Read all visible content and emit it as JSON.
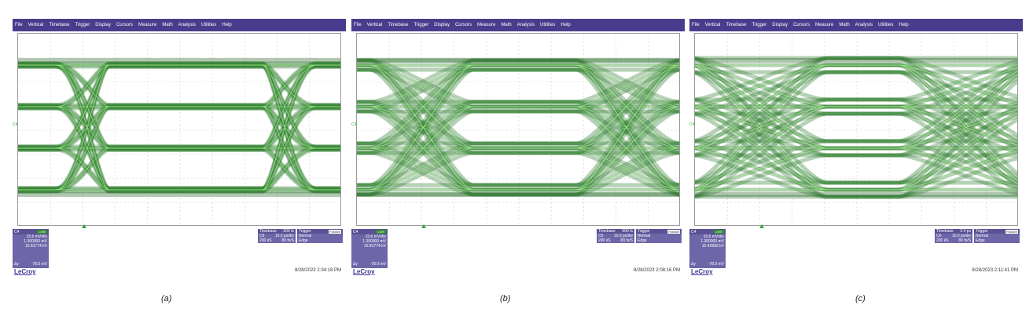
{
  "menu_items": [
    "File",
    "Vertical",
    "Timebase",
    "Trigger",
    "Display",
    "Cursors",
    "Measure",
    "Math",
    "Analysis",
    "Utilities",
    "Help"
  ],
  "colors": {
    "menubar": "#4a3c8c",
    "trace": "#2f8a2f",
    "trace_bright": "#b6f0a0",
    "box": "#6d66a8"
  },
  "panels": [
    {
      "caption": "(a)",
      "channel": {
        "name": "C4",
        "tag": "LIVE",
        "vdiv": "15.6 mV/div",
        "offset": "1.300000 mV",
        "value": "10.81774 kV",
        "dy_label": "Δy",
        "dy": "-78.0 mV"
      },
      "timebase": {
        "title": "Timebase",
        "delay": "-200 fs",
        "sub_label": "C6",
        "rate": "10.0 ps/div",
        "samples": "200 kS",
        "sr": "80 fs/S"
      },
      "trigger": {
        "title": "Trigger",
        "tag": "Positive",
        "mode": "Normal",
        "type": "Edge"
      },
      "ch_axis_label": "C4",
      "timestamp": "8/28/2023 2:34:18 PM",
      "logo": "LeCroy"
    },
    {
      "caption": "(b)",
      "channel": {
        "name": "C4",
        "tag": "LIVE",
        "vdiv": "15.6 mV/div",
        "offset": "1.300000 mV",
        "value": "10.81774 kV",
        "dy_label": "Δy",
        "dy": "-78.0 mV"
      },
      "timebase": {
        "title": "Timebase",
        "delay": "500 fs",
        "sub_label": "C6",
        "rate": "10.0 ps/div",
        "samples": "200 kS",
        "sr": "80 fs/S"
      },
      "trigger": {
        "title": "Trigger",
        "tag": "Positive",
        "mode": "Normal",
        "type": "Edge"
      },
      "ch_axis_label": "C4",
      "timestamp": "8/28/2023 2:08:16 PM",
      "logo": "LeCroy"
    },
    {
      "caption": "(c)",
      "channel": {
        "name": "C4",
        "tag": "LIVE",
        "vdiv": "15.6 mV/div",
        "offset": "1.300000 mV",
        "value": "10.43966 kV",
        "dy_label": "Δy",
        "dy": "-78.0 mV"
      },
      "timebase": {
        "title": "Timebase",
        "delay": "2.4 ps",
        "sub_label": "C6",
        "rate": "10.0 ps/div",
        "samples": "200 kS",
        "sr": "80 fs/S"
      },
      "trigger": {
        "title": "Trigger",
        "tag": "Positive",
        "mode": "Normal",
        "type": "Edge"
      },
      "ch_axis_label": "C4",
      "timestamp": "8/28/2023 2:11:41 PM",
      "logo": "LeCroy"
    }
  ]
}
